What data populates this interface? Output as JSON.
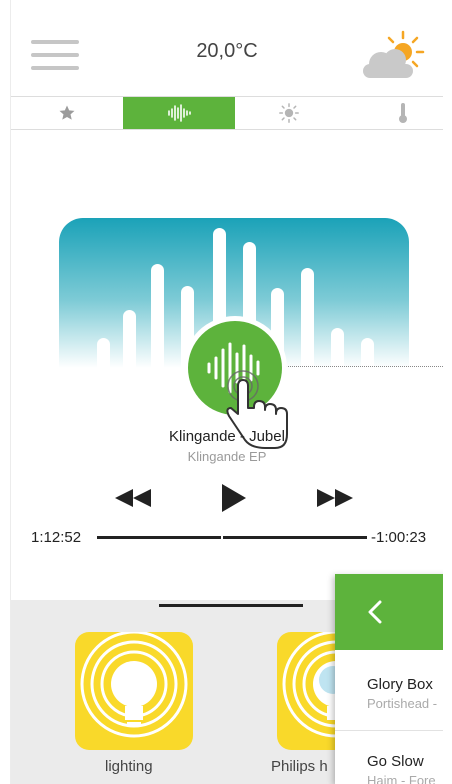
{
  "header": {
    "temperature": "20,0°C"
  },
  "icons": {
    "menu": "hamburger-menu-icon",
    "weather": "partly-cloudy-icon",
    "tabs": [
      "star-icon",
      "soundwave-icon",
      "sun-icon",
      "thermometer-icon"
    ]
  },
  "player": {
    "track_title": "Klingande - Jubel",
    "track_album": "Klingande EP",
    "elapsed": "1:12:52",
    "remaining": "-1:00:23"
  },
  "tiles": [
    {
      "label": "lighting"
    },
    {
      "label": "Philips h"
    }
  ],
  "playlist": [
    {
      "title": "Glory Box",
      "artist": "Portishead -"
    },
    {
      "title": "Go Slow",
      "artist": "Haim - Fore"
    }
  ],
  "colors": {
    "accent_green": "#5db33c",
    "gradient_top": "#1ba2b8",
    "tile_yellow": "#f9d92a",
    "sun_orange": "#f5a623"
  }
}
